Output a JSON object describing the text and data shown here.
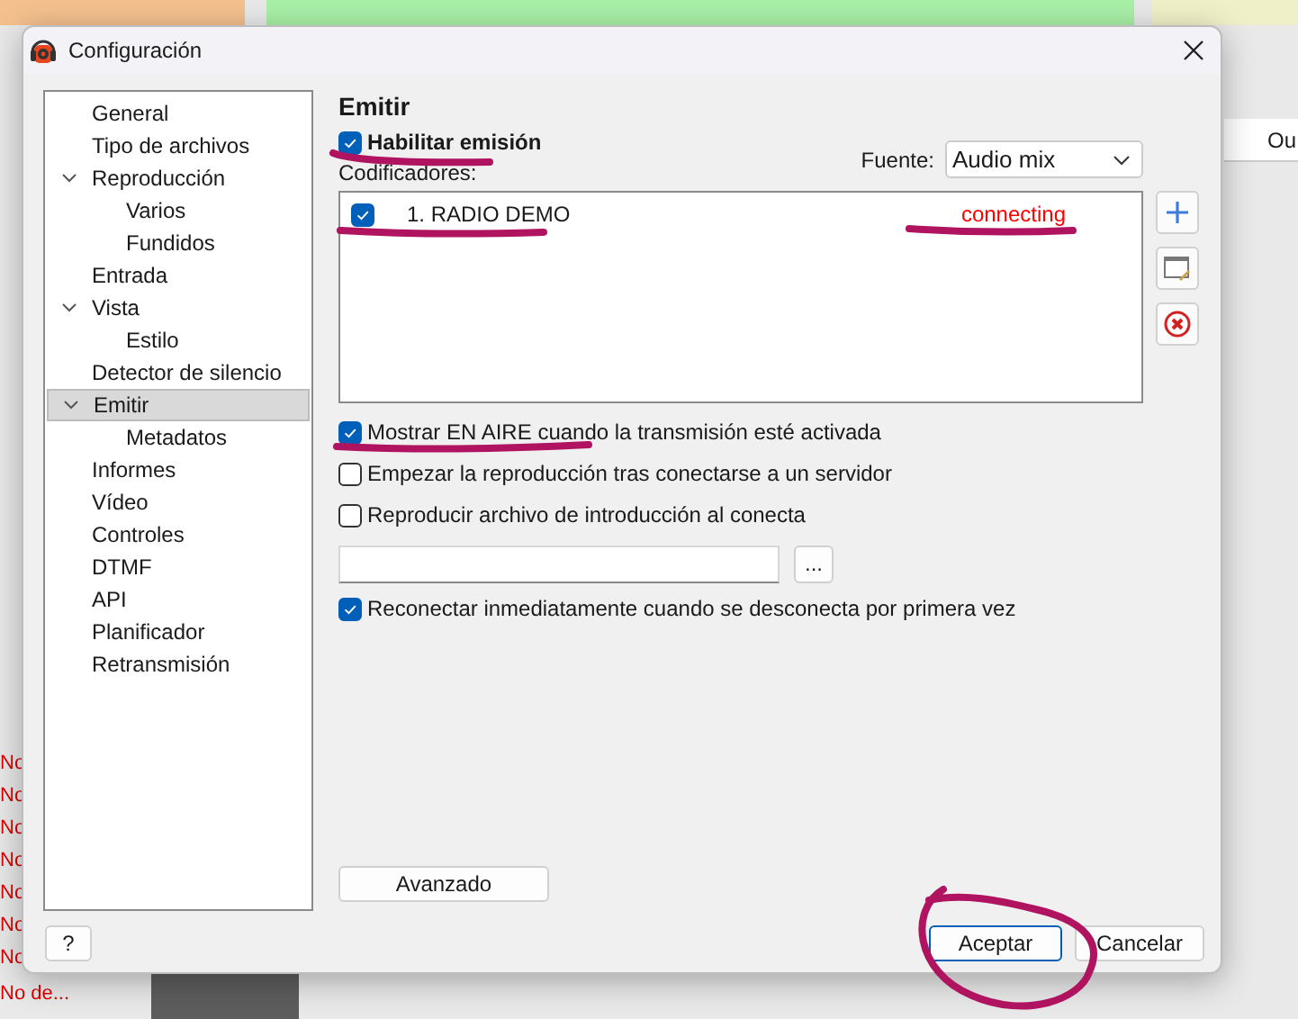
{
  "background": {
    "left_items": [
      "No",
      "No",
      "No",
      "No",
      "No",
      "No",
      "No",
      "No de..."
    ],
    "right_header": "Ou"
  },
  "window": {
    "title": "Configuración"
  },
  "tree": [
    {
      "label": "General",
      "selected": false
    },
    {
      "label": "Tipo de archivos",
      "selected": false
    },
    {
      "label": "Reproducción",
      "selected": false,
      "expanded": true,
      "children": [
        {
          "label": "Varios",
          "selected": false
        },
        {
          "label": "Fundidos",
          "selected": false
        }
      ]
    },
    {
      "label": "Entrada",
      "selected": false
    },
    {
      "label": "Vista",
      "selected": false,
      "expanded": true,
      "children": [
        {
          "label": "Estilo",
          "selected": false
        }
      ]
    },
    {
      "label": "Detector de silencio",
      "selected": false
    },
    {
      "label": "Emitir",
      "selected": true,
      "expanded": true,
      "children": [
        {
          "label": "Metadatos",
          "selected": false
        }
      ]
    },
    {
      "label": "Informes",
      "selected": false
    },
    {
      "label": "Vídeo",
      "selected": false
    },
    {
      "label": "Controles",
      "selected": false
    },
    {
      "label": "DTMF",
      "selected": false
    },
    {
      "label": "API",
      "selected": false
    },
    {
      "label": "Planificador",
      "selected": false
    },
    {
      "label": "Retransmisión",
      "selected": false
    }
  ],
  "panel": {
    "heading": "Emitir",
    "enable": {
      "label": "Habilitar emisión",
      "checked": true
    },
    "source": {
      "label": "Fuente:",
      "value": "Audio mix"
    },
    "encoders_label": "Codificadores:",
    "encoders": [
      {
        "name": "1. RADIO DEMO",
        "checked": true,
        "status": "connecting",
        "color": "#ff0000"
      }
    ],
    "options": [
      {
        "label": "Mostrar EN AIRE cuando la transmisión esté activada",
        "checked": true
      },
      {
        "label": "Empezar la reproducción tras conectarse a un servidor",
        "checked": false
      },
      {
        "label": "Reproducir archivo de introducción al conecta",
        "checked": false
      }
    ],
    "browse_button": "...",
    "reconnect": {
      "label": "Reconectar inmediatamente cuando se desconecta por primera vez",
      "checked": true
    },
    "advanced_button": "Avanzado"
  },
  "footer": {
    "help_button": "?",
    "ok_button": "Aceptar",
    "cancel_button": "Cancelar"
  }
}
